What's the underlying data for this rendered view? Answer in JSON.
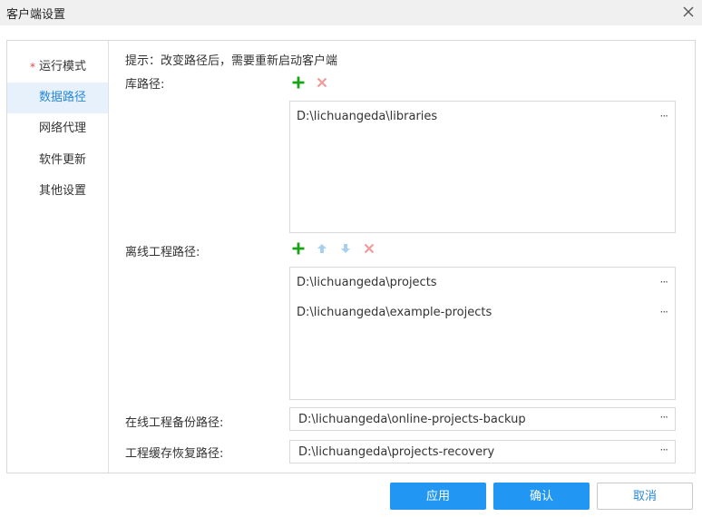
{
  "window": {
    "title": "客户端设置",
    "close_icon": "close-icon"
  },
  "sidebar": {
    "items": [
      {
        "label": "运行模式",
        "required": "*"
      },
      {
        "label": "数据路径",
        "active": true
      },
      {
        "label": "网络代理"
      },
      {
        "label": "软件更新"
      },
      {
        "label": "其他设置"
      }
    ]
  },
  "main": {
    "hint": "提示：改变路径后，需要重新启动客户端",
    "library": {
      "label": "库路径:",
      "toolbar": [
        "add-icon",
        "delete-icon"
      ],
      "paths": [
        "D:\\lichuangeda\\libraries"
      ],
      "more_label": "···"
    },
    "offline": {
      "label": "离线工程路径:",
      "toolbar": [
        "add-icon",
        "move-up-icon",
        "move-down-icon",
        "delete-icon"
      ],
      "paths": [
        "D:\\lichuangeda\\projects",
        "D:\\lichuangeda\\example-projects"
      ],
      "more_label": "···"
    },
    "online_backup": {
      "label": "在线工程备份路径:",
      "value": "D:\\lichuangeda\\online-projects-backup",
      "more_label": "···"
    },
    "recovery": {
      "label": "工程缓存恢复路径:",
      "value": "D:\\lichuangeda\\projects-recovery",
      "more_label": "···"
    }
  },
  "footer": {
    "apply": "应用",
    "confirm": "确认",
    "cancel": "取消"
  },
  "colors": {
    "primary": "#2196f3",
    "add_green": "#1aa11a",
    "delete_red": "#f19b9b",
    "arrow_blue": "#a7cff2",
    "active_bg": "#e6f1fb",
    "active_text": "#2b88d8"
  }
}
